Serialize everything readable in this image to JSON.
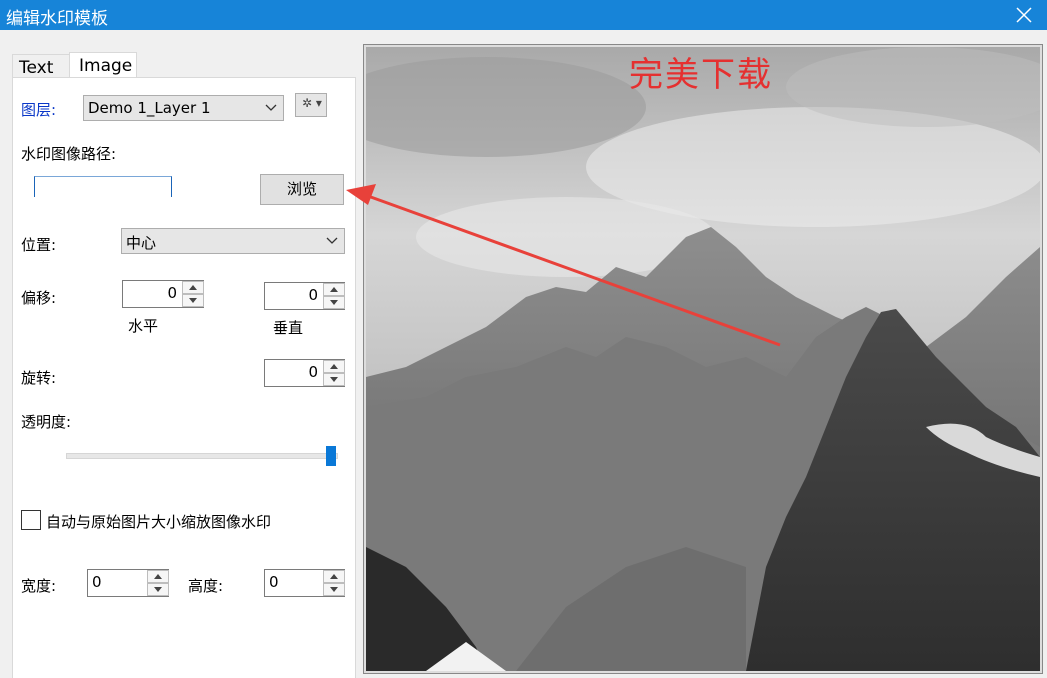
{
  "window": {
    "title": "编辑水印模板"
  },
  "tabs": [
    {
      "label": "Text",
      "active": false
    },
    {
      "label": "Image",
      "active": true
    }
  ],
  "layer": {
    "label": "图层:",
    "value": "Demo 1_Layer 1"
  },
  "image_path": {
    "label": "水印图像路径:",
    "value": "",
    "browse_label": "浏览"
  },
  "position": {
    "label": "位置:",
    "value": "中心"
  },
  "offset": {
    "label": "偏移:",
    "horizontal": {
      "value": "0",
      "caption": "水平"
    },
    "vertical": {
      "value": "0",
      "caption": "垂直"
    }
  },
  "rotation": {
    "label": "旋转:",
    "value": "0"
  },
  "opacity": {
    "label": "透明度:",
    "level": 1.0
  },
  "auto_scale": {
    "label": "自动与原始图片大小缩放图像水印",
    "checked": false
  },
  "size": {
    "width_label": "宽度:",
    "width_value": "0",
    "height_label": "高度:",
    "height_value": "0"
  },
  "preview": {
    "watermark_text": "完美下载",
    "watermark_color": "#e53030"
  },
  "colors": {
    "titlebar": "#1784d8",
    "accent": "#0a78d7",
    "label_blue": "#0a37c8",
    "arrow": "#e8413a"
  },
  "icons": {
    "close": "close-icon",
    "gear": "gear-icon",
    "dropdown": "chevron-down-icon"
  }
}
